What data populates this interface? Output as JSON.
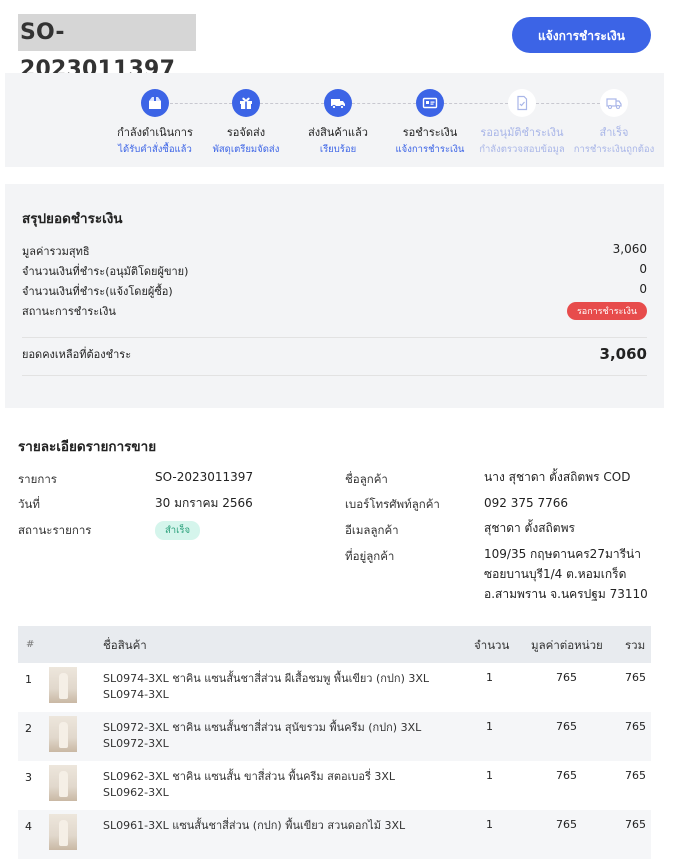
{
  "order_id": "SO-2023011397",
  "notify_button": "แจ้งการชำระเงิน",
  "steps": [
    {
      "title": "กำลังดำเนินการ",
      "subtitle": "ได้รับคำสั่งซื้อแล้ว",
      "icon": "box-icon",
      "active": true
    },
    {
      "title": "รอจัดส่ง",
      "subtitle": "พัสดุเตรียมจัดส่ง",
      "icon": "gift-icon",
      "active": true
    },
    {
      "title": "ส่งสินค้าแล้ว",
      "subtitle": "เรียบร้อย",
      "icon": "truck-icon",
      "active": true
    },
    {
      "title": "รอชำระเงิน",
      "subtitle": "แจ้งการชำระเงิน",
      "icon": "payment-icon",
      "active": true
    },
    {
      "title": "รออนุมัติชำระเงิน",
      "subtitle": "กำลังตรวจสอบข้อมูล",
      "icon": "document-check-icon",
      "active": false
    },
    {
      "title": "สำเร็จ",
      "subtitle": "การชำระเงินถูกต้อง",
      "icon": "truck-icon",
      "active": false
    }
  ],
  "summary": {
    "title": "สรุปยอดชำระเงิน",
    "net_label": "มูลค่ารวมสุทธิ",
    "net_value": "3,060",
    "paid_seller_label": "จำนวนเงินที่ชำระ(อนุมัติโดยผู้ขาย)",
    "paid_seller_value": "0",
    "paid_buyer_label": "จำนวนเงินที่ชำระ(แจ้งโดยผู้ซื้อ)",
    "paid_buyer_value": "0",
    "status_label": "สถานะการชำระเงิน",
    "status_badge": "รอการชำระเงิน",
    "balance_label": "ยอดคงเหลือที่ต้องชำระ",
    "balance_value": "3,060"
  },
  "detail": {
    "title": "รายละเอียดรายการขาย",
    "order_label": "รายการ",
    "order_value": "SO-2023011397",
    "date_label": "วันที่",
    "date_value": "30 มกราคม 2566",
    "status_label": "สถานะรายการ",
    "status_value": "สำเร็จ",
    "customer_label": "ชื่อลูกค้า",
    "customer_value": "นาง สุชาดา ตั้งสถิตพร COD",
    "phone_label": "เบอร์โทรศัพท์ลูกค้า",
    "phone_value": "092 375 7766",
    "email_label": "อีเมลลูกค้า",
    "email_value": "สุชาดา ตั้งสถิตพร",
    "address_label": "ที่อยู่ลูกค้า",
    "address_lines": [
      "109/35 กฤษดานคร27มารีน่า",
      "ซอยบานบุรี1/4 ต.หอมเกร็ด",
      "อ.สามพราน จ.นครปฐม 73110"
    ]
  },
  "table": {
    "headers": {
      "num": "#",
      "name": "ชื่อสินค้า",
      "qty": "จำนวน",
      "unit": "มูลค่าต่อหน่วย",
      "total": "รวม"
    },
    "rows": [
      {
        "num": "1",
        "name": "SL0974-3XL ชาคิน แซนสั้นชาสี่ส่วน ผีเสื้อชมพู พื้นเขียว (กปก) 3XL",
        "sku": "SL0974-3XL",
        "qty": "1",
        "unit": "765",
        "total": "765"
      },
      {
        "num": "2",
        "name": "SL0972-3XL ชาคิน แซนสั้นชาสี่ส่วน สุนัขรวม พื้นครีม (กปก) 3XL",
        "sku": "SL0972-3XL",
        "qty": "1",
        "unit": "765",
        "total": "765"
      },
      {
        "num": "3",
        "name": "SL0962-3XL ชาคิน แซนสั้น ขาสี่ส่วน พื้นครีม สตอเบอรี่ 3XL",
        "sku": "SL0962-3XL",
        "qty": "1",
        "unit": "765",
        "total": "765"
      },
      {
        "num": "4",
        "name": "SL0961-3XL แซนสั้นชาสี่ส่วน (กปก) พื้นเขียว สวนดอกไม้ 3XL",
        "sku": "",
        "qty": "1",
        "unit": "765",
        "total": "765"
      }
    ]
  },
  "colors": {
    "primary": "#3c64e6",
    "danger": "#e74c4c",
    "success_bg": "#d5f5ec",
    "success_text": "#2aa07a"
  }
}
